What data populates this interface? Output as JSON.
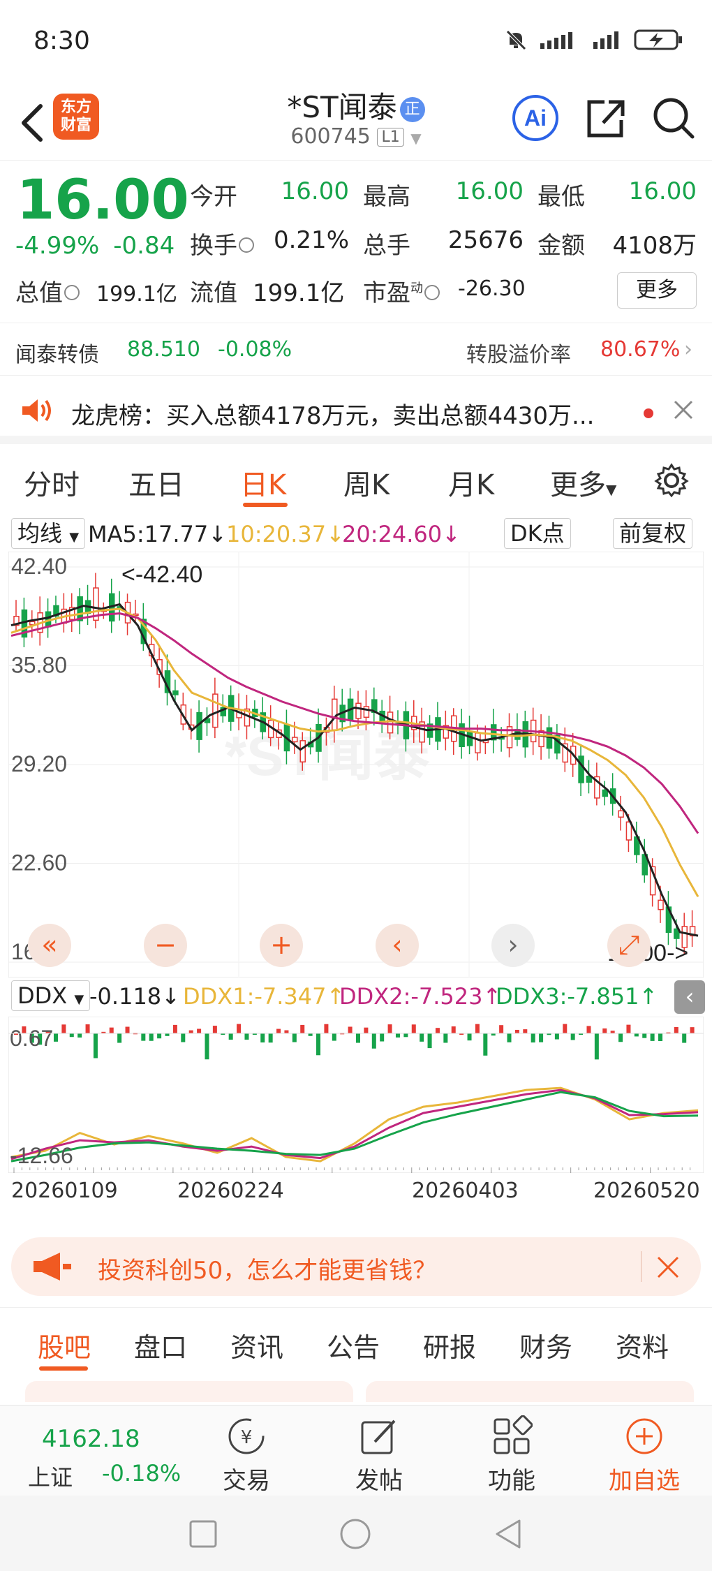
{
  "status_bar": {
    "time": "8:30"
  },
  "header": {
    "logo_line1": "东方",
    "logo_line2": "财富",
    "stock_name": "*ST闻泰",
    "badge": "正",
    "stock_code": "600745",
    "level_badge": "L1",
    "ai_label": "Ai"
  },
  "quote": {
    "price": "16.00",
    "change_pct": "-4.99%",
    "change_amt": "-0.84",
    "open_label": "今开",
    "open": "16.00",
    "high_label": "最高",
    "high": "16.00",
    "low_label": "最低",
    "low": "16.00",
    "turnover_label": "换手",
    "turnover": "0.21%",
    "volume_label": "总手",
    "volume": "25676",
    "amount_label": "金额",
    "amount": "4108万",
    "mktcap_label": "总值",
    "mktcap": "199.1亿",
    "float_label": "流值",
    "float_cap": "199.1亿",
    "pe_label": "市盈",
    "pe_sup": "动",
    "pe": "-26.30",
    "more": "更多",
    "colors": {
      "down": "#16a34a",
      "up": "#e53935",
      "accent": "#f05a22"
    }
  },
  "bond": {
    "name": "闻泰转债",
    "price": "88.510",
    "change": "-0.08%",
    "premium_label": "转股溢价率",
    "premium": "80.67%"
  },
  "notice": {
    "text": "龙虎榜：买入总额4178万元，卖出总额4430万..."
  },
  "chart_tabs": {
    "items": [
      "分时",
      "五日",
      "日K",
      "周K",
      "月K",
      "更多"
    ],
    "active": "日K"
  },
  "ma_row": {
    "selector": "均线",
    "ma5": "MA5:17.77",
    "ma10": "10:20.37",
    "ma20": "20:24.60",
    "dk": "DK点",
    "adjust": "前复权",
    "colors": {
      "ma5": "#222222",
      "ma10": "#e8b63a",
      "ma20": "#c0267e"
    }
  },
  "chart_data": [
    {
      "type": "candlestick",
      "ylim": [
        16.0,
        42.4
      ],
      "y_ticks": [
        "42.40",
        "35.80",
        "29.20",
        "22.60",
        "16.00"
      ],
      "max_annotation": "<-42.40",
      "last_annotation": "16.00->",
      "x_ticks": [
        "20260109",
        "20260224",
        "20260403",
        "20260520"
      ],
      "series": [
        {
          "name": "MA5",
          "values": [
            38.5,
            38.8,
            39.0,
            39.4,
            39.8,
            39.6,
            39.9,
            38.5,
            36.0,
            33.5,
            31.5,
            32.5,
            33.0,
            32.5,
            32.0,
            31.2,
            30.2,
            31.0,
            32.5,
            33.0,
            32.8,
            32.2,
            31.8,
            31.5,
            31.6,
            31.2,
            30.8,
            31.0,
            31.3,
            31.2,
            31.0,
            30.0,
            28.5,
            27.5,
            26.0,
            23.5,
            20.5,
            18.0,
            17.77
          ]
        },
        {
          "name": "MA10",
          "values": [
            38.0,
            38.4,
            38.8,
            39.1,
            39.3,
            39.5,
            39.6,
            39.0,
            37.5,
            35.5,
            34.0,
            33.5,
            33.0,
            32.8,
            32.4,
            32.0,
            31.6,
            31.4,
            31.5,
            31.8,
            32.0,
            32.1,
            32.0,
            31.8,
            31.6,
            31.5,
            31.3,
            31.2,
            31.1,
            31.2,
            31.1,
            30.8,
            30.2,
            29.5,
            28.5,
            27.0,
            25.0,
            22.5,
            20.37
          ]
        },
        {
          "name": "MA20",
          "values": [
            37.8,
            38.1,
            38.4,
            38.7,
            39.0,
            39.2,
            39.3,
            39.0,
            38.3,
            37.5,
            36.6,
            35.8,
            35.0,
            34.4,
            33.9,
            33.4,
            33.0,
            32.6,
            32.3,
            32.1,
            32.0,
            31.9,
            31.8,
            31.8,
            31.7,
            31.6,
            31.6,
            31.5,
            31.5,
            31.4,
            31.3,
            31.1,
            30.8,
            30.4,
            29.8,
            29.0,
            27.9,
            26.4,
            24.6
          ]
        }
      ]
    },
    {
      "type": "line",
      "title": "DDX",
      "value": "-0.118",
      "y_ticks": [
        "0.67",
        "-12.66"
      ],
      "series": [
        {
          "name": "DDX1",
          "label": "DDX1:-7.347",
          "values": [
            -11.8,
            -11.2,
            -9.5,
            -10.6,
            -9.8,
            -10.5,
            -11.4,
            -10.0,
            -11.8,
            -12.2,
            -10.5,
            -8.2,
            -7.0,
            -6.6,
            -6.0,
            -5.4,
            -5.2,
            -6.3,
            -8.2,
            -7.6,
            -7.347
          ]
        },
        {
          "name": "DDX2",
          "label": "DDX2:-7.523",
          "values": [
            -12.0,
            -11.0,
            -10.2,
            -10.4,
            -10.2,
            -10.8,
            -11.2,
            -10.8,
            -11.6,
            -11.9,
            -10.8,
            -9.0,
            -7.6,
            -7.0,
            -6.4,
            -5.8,
            -5.4,
            -6.2,
            -7.8,
            -7.7,
            -7.523
          ]
        },
        {
          "name": "DDX3",
          "label": "DDX3:-7.851",
          "values": [
            -12.2,
            -11.6,
            -10.9,
            -10.5,
            -10.4,
            -10.7,
            -11.0,
            -11.2,
            -11.5,
            -11.6,
            -11.0,
            -9.7,
            -8.5,
            -7.7,
            -7.0,
            -6.3,
            -5.6,
            -6.1,
            -7.4,
            -7.9,
            -7.851
          ]
        }
      ]
    }
  ],
  "ad": {
    "text": "投资科创50，怎么才能更省钱？"
  },
  "sub_tabs": {
    "items": [
      "股吧",
      "盘口",
      "资讯",
      "公告",
      "研报",
      "财务",
      "资料"
    ],
    "active": "股吧"
  },
  "bottom_bar": {
    "index_value": "4162.18",
    "index_name": "上证",
    "index_change": "-0.18%",
    "trade": "交易",
    "post": "发帖",
    "function": "功能",
    "add_watch": "加自选"
  }
}
